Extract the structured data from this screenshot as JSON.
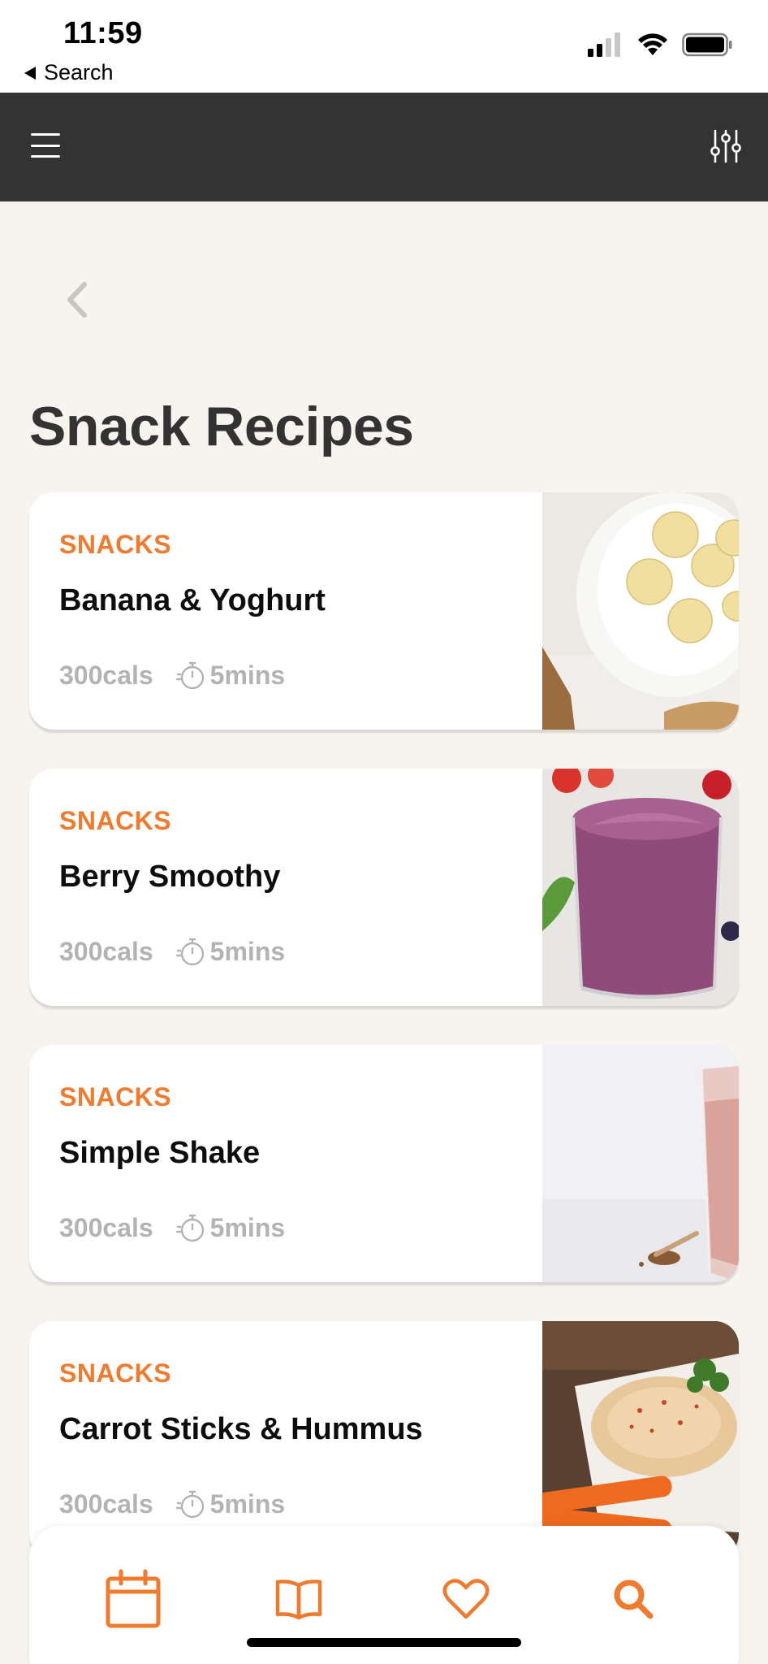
{
  "status_bar": {
    "time": "11:59",
    "back_label": "Search"
  },
  "page": {
    "title": "Snack Recipes"
  },
  "recipes": [
    {
      "category": "SNACKS",
      "name": "Banana & Yoghurt",
      "cals": "300cals",
      "time": "5mins",
      "image": "banana-yoghurt-photo"
    },
    {
      "category": "SNACKS",
      "name": "Berry Smoothy",
      "cals": "300cals",
      "time": "5mins",
      "image": "berry-smoothie-photo"
    },
    {
      "category": "SNACKS",
      "name": "Simple Shake",
      "cals": "300cals",
      "time": "5mins",
      "image": "pink-shake-photo"
    },
    {
      "category": "SNACKS",
      "name": "Carrot Sticks & Hummus",
      "cals": "300cals",
      "time": "5mins",
      "image": "carrot-hummus-photo"
    }
  ],
  "tab_bar": {
    "tabs": [
      {
        "icon": "calendar-icon"
      },
      {
        "icon": "book-icon"
      },
      {
        "icon": "heart-icon"
      },
      {
        "icon": "search-icon"
      }
    ]
  },
  "colors": {
    "accent": "#f07a2d",
    "header_bg": "#333333",
    "page_bg": "#f7f3ee",
    "meta_text": "#b3b3b3"
  }
}
